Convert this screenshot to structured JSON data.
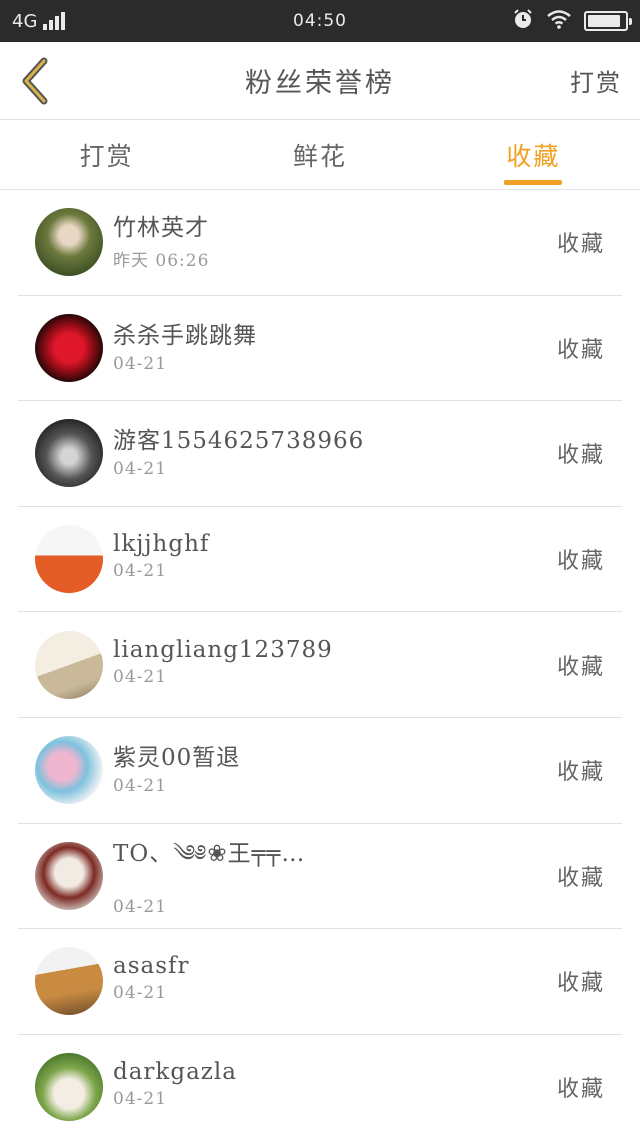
{
  "status_bar": {
    "network": "4G",
    "time": "04:50",
    "battery_level": 0.9
  },
  "header": {
    "title": "粉丝荣誉榜",
    "right_action": "打赏"
  },
  "tabs": [
    {
      "label": "打赏",
      "active": false
    },
    {
      "label": "鲜花",
      "active": false
    },
    {
      "label": "收藏",
      "active": true
    }
  ],
  "accent_color": "#f2a023",
  "fans": [
    {
      "name": "竹林英才",
      "time": "昨天 06:26",
      "action": "收藏"
    },
    {
      "name": "杀杀手跳跳舞",
      "time": "04-21",
      "action": "收藏"
    },
    {
      "name": "游客1554625738966",
      "time": "04-21",
      "action": "收藏"
    },
    {
      "name": "lkjjhghf",
      "time": "04-21",
      "action": "收藏"
    },
    {
      "name": "liangliang123789",
      "time": "04-21",
      "action": "收藏"
    },
    {
      "name": "紫灵00暂退",
      "time": "04-21",
      "action": "收藏"
    },
    {
      "name": "TO、༄༅❀王╤╤…",
      "time": "04-21",
      "action": "收藏"
    },
    {
      "name": "asasfr",
      "time": "04-21",
      "action": "收藏"
    },
    {
      "name": "darkgazla",
      "time": "04-21",
      "action": "收藏"
    }
  ]
}
